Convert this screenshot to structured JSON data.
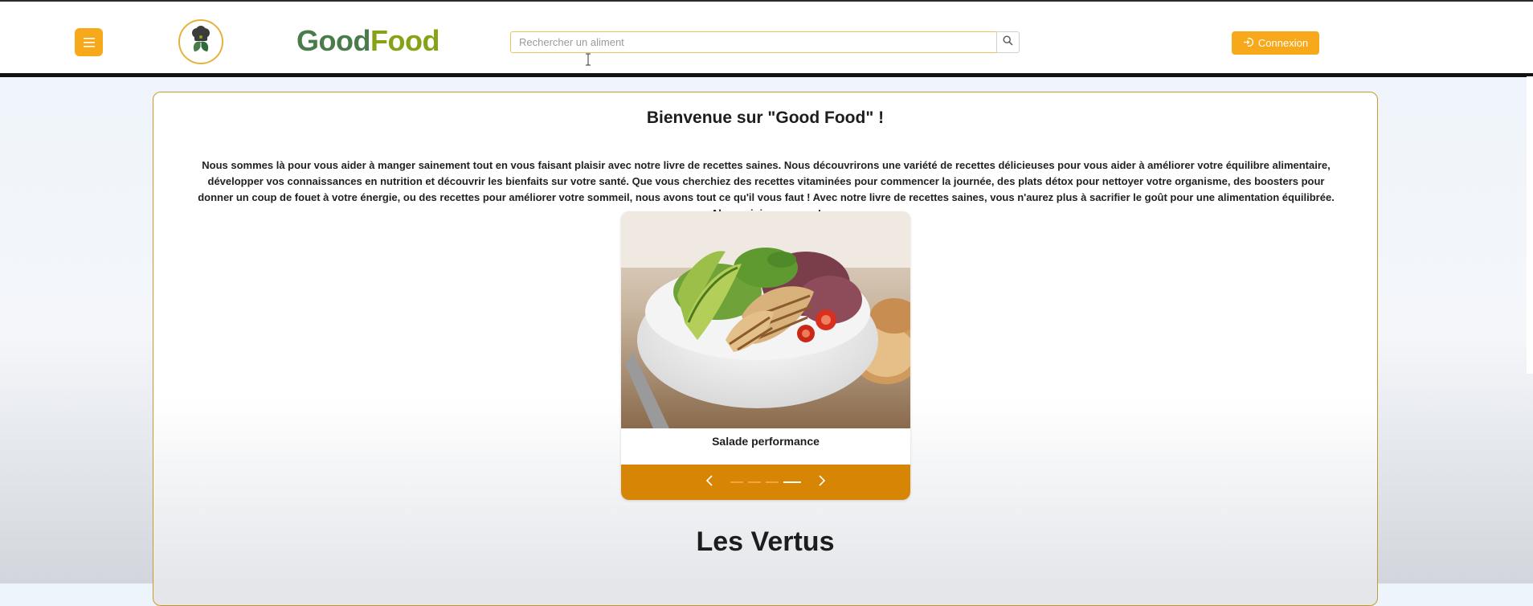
{
  "header": {
    "menu_icon": "hamburger-icon",
    "logo_icon": "chef-hat-leaf-icon",
    "brand": {
      "part1": "Good",
      "part2": "Food"
    },
    "search": {
      "placeholder": "Rechercher un aliment",
      "value": "",
      "icon": "search-icon"
    },
    "login": {
      "label": "Connexion",
      "icon": "login-icon"
    }
  },
  "welcome": {
    "title": "Bienvenue sur \"Good Food\" !",
    "text": "Nous sommes là pour vous aider à manger sainement tout en vous faisant plaisir avec notre livre de recettes saines. Nous découvrirons une variété de recettes délicieuses pour vous aider à améliorer votre équilibre alimentaire, développer vos connaissances en nutrition et découvrir les bienfaits sur votre santé. Que vous cherchiez des recettes vitaminées pour commencer la journée, des plats détox pour nettoyer votre organisme, des boosters pour donner un coup de fouet à votre énergie, ou des recettes pour améliorer votre sommeil, nous avons tout ce qu'il vous faut ! Avec notre livre de recettes saines, vous n'aurez plus à sacrifier le goût pour une alimentation équilibrée. Alors rejoignez-nous !"
  },
  "carousel": {
    "caption": "Salade performance",
    "slide_count": 4,
    "active_index": 3,
    "prev_icon": "chevron-left-icon",
    "next_icon": "chevron-right-icon"
  },
  "section": {
    "title": "Les Vertus"
  },
  "colors": {
    "accent": "#f7a81b",
    "carousel_bar": "#d68504",
    "brand_green_dark": "#4a7c4b",
    "brand_green_light": "#86a316"
  }
}
